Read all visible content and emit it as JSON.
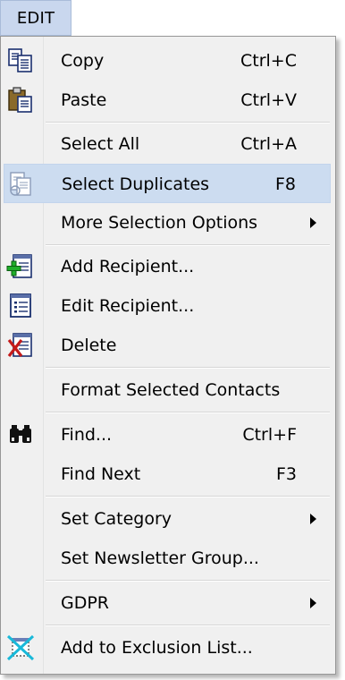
{
  "menu": {
    "title": "EDIT"
  },
  "items": [
    {
      "label": "Copy",
      "shortcut": "Ctrl+C",
      "icon": "copy-icon"
    },
    {
      "label": "Paste",
      "shortcut": "Ctrl+V",
      "icon": "paste-icon"
    },
    {
      "label": "Select All",
      "shortcut": "Ctrl+A"
    },
    {
      "label": "Select Duplicates",
      "shortcut": "F8",
      "icon": "select-duplicates-icon",
      "highlighted": true
    },
    {
      "label": "More Selection Options",
      "submenu": true
    },
    {
      "label": "Add Recipient...",
      "icon": "add-recipient-icon"
    },
    {
      "label": "Edit Recipient...",
      "icon": "edit-recipient-icon"
    },
    {
      "label": "Delete",
      "icon": "delete-icon"
    },
    {
      "label": "Format Selected Contacts"
    },
    {
      "label": "Find...",
      "shortcut": "Ctrl+F",
      "icon": "binoculars-icon"
    },
    {
      "label": "Find Next",
      "shortcut": "F3"
    },
    {
      "label": "Set Category",
      "submenu": true
    },
    {
      "label": "Set Newsletter Group..."
    },
    {
      "label": "GDPR",
      "submenu": true
    },
    {
      "label": "Add to Exclusion List...",
      "icon": "exclusion-icon"
    }
  ],
  "colors": {
    "highlight": "#ccdcf0",
    "menu_background": "#f0f0f0",
    "title_background": "#c9d7ee"
  }
}
